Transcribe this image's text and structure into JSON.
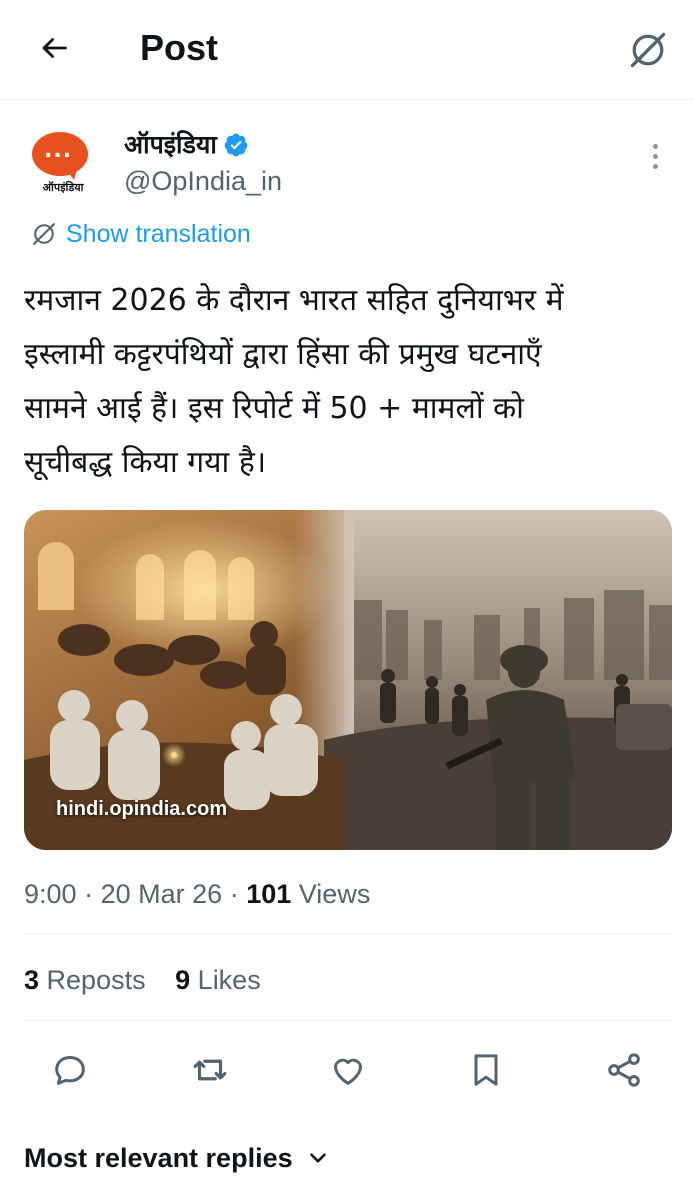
{
  "header": {
    "title": "Post",
    "back_icon": "arrow-left-icon",
    "translate_icon": "translate-slash-icon"
  },
  "author": {
    "display_name": "ऑपइंडिया",
    "handle": "@OpIndia_in",
    "verified": true,
    "avatar_icon": "chat-bubble-logo",
    "avatar_dots": "...",
    "avatar_text": "ऑपइंडिया",
    "avatar_color": "#e8501e"
  },
  "show_translation": "Show translation",
  "post_text_lines": [
    "रमजान 2026 के दौरान भारत सहित दुनियाभर में",
    "इस्लामी कट्टरपंथियों द्वारा हिंसा की प्रमुख घटनाएँ",
    "सामने आई हैं। इस रिपोर्ट में 50 + मामलों को",
    "सूचीबद्ध किया गया है।"
  ],
  "media": {
    "caption": "hindi.opindia.com"
  },
  "meta": {
    "time": "9:00",
    "date": "20 Mar 26",
    "views_count": "101",
    "views_label": "Views",
    "separator": "·"
  },
  "stats": {
    "reposts_count": "3",
    "reposts_label": "Reposts",
    "likes_count": "9",
    "likes_label": "Likes"
  },
  "actions": [
    "reply-icon",
    "repost-icon",
    "like-icon",
    "bookmark-icon",
    "share-icon"
  ],
  "replies_sort": {
    "label": "Most relevant replies",
    "icon": "chevron-down-icon"
  },
  "colors": {
    "accent": "#1d9bf0",
    "text_primary": "#0f1419",
    "text_secondary": "#536471"
  }
}
